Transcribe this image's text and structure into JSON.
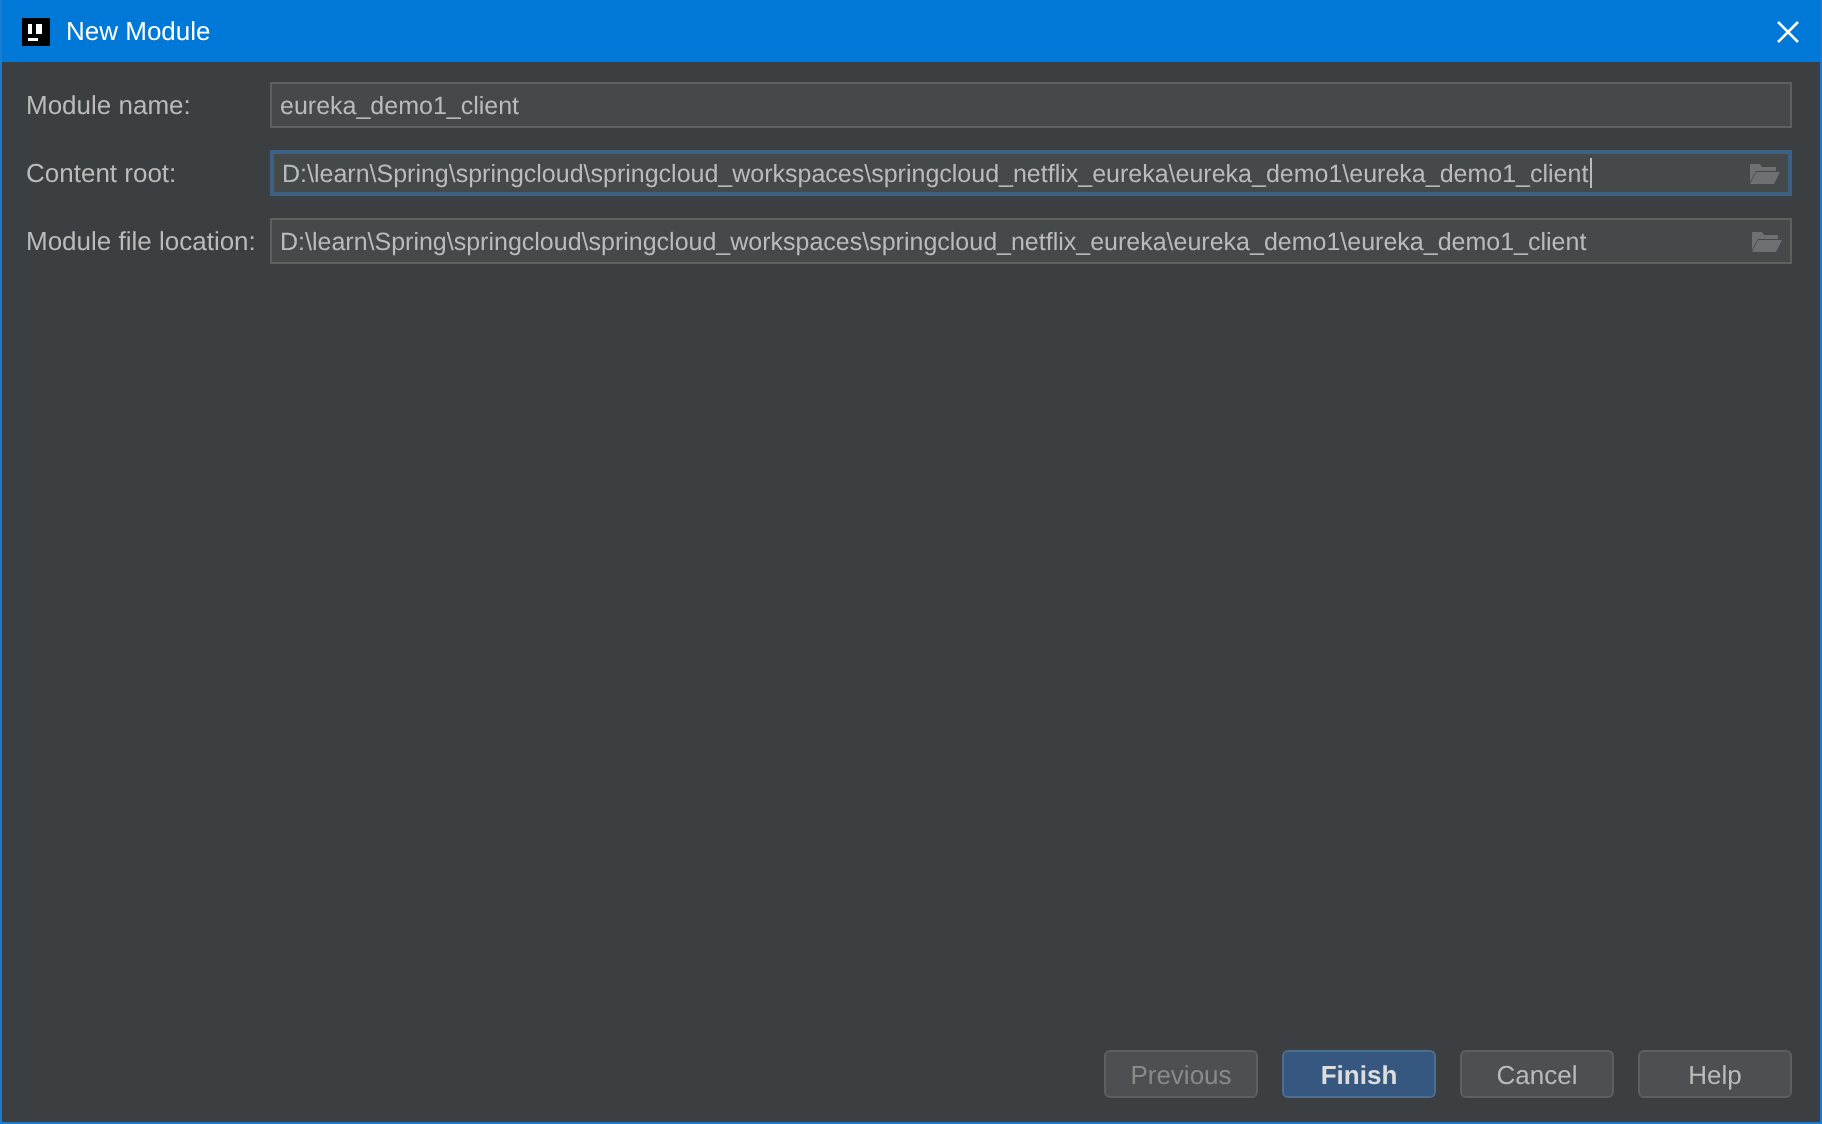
{
  "window": {
    "title": "New Module"
  },
  "fields": [
    {
      "label": "Module name:",
      "value": "eureka_demo1_client",
      "focused": false,
      "browse": false
    },
    {
      "label": "Content root:",
      "value": "D:\\learn\\Spring\\springcloud\\springcloud_workspaces\\springcloud_netflix_eureka\\eureka_demo1\\eureka_demo1_client",
      "focused": true,
      "browse": true
    },
    {
      "label": "Module file location:",
      "value": "D:\\learn\\Spring\\springcloud\\springcloud_workspaces\\springcloud_netflix_eureka\\eureka_demo1\\eureka_demo1_client",
      "focused": false,
      "browse": true
    }
  ],
  "buttons": [
    {
      "label": "Previous",
      "kind": "normal",
      "disabled": true
    },
    {
      "label": "Finish",
      "kind": "default",
      "disabled": false
    },
    {
      "label": "Cancel",
      "kind": "normal",
      "disabled": false
    },
    {
      "label": "Help",
      "kind": "normal",
      "disabled": false
    }
  ]
}
